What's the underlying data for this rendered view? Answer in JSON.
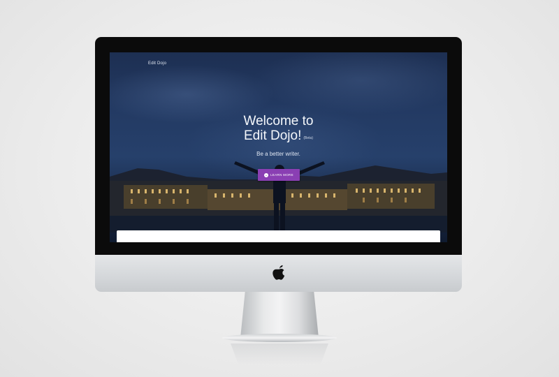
{
  "site": {
    "brand": "Edit Dojo",
    "hero_line1": "Welcome to",
    "hero_line2": "Edit Dojo!",
    "beta_badge": "(Beta)",
    "tagline": "Be a better writer.",
    "cta_label": "LEARN MORE",
    "cta_icon": "chevron-down-icon"
  },
  "device": {
    "logo": "apple-logo"
  },
  "colors": {
    "accent": "#8a3fb3",
    "sky": "#233a63"
  }
}
